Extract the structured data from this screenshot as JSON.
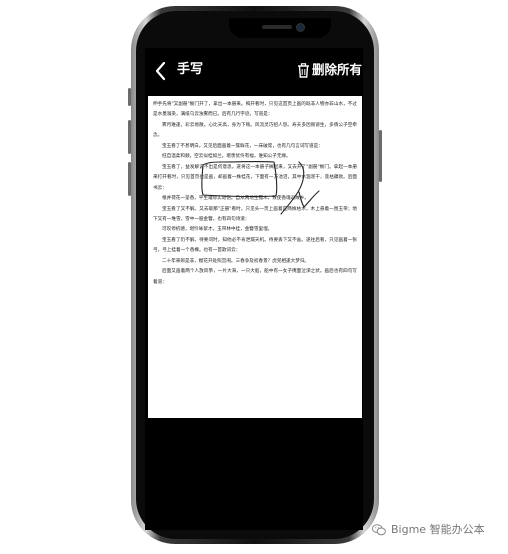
{
  "header": {
    "title": "手写",
    "delete_label": "删除所有",
    "back_icon": "chevron-left-icon",
    "trash_icon": "trash-icon"
  },
  "document": {
    "paragraphs": [
      "伸手先将\"又副册\"橱门开了，拿出一本册来。揭开看时，只见这首页上画的既非人物亦非山水，不过是水墨滃染，满纸乌云浊雾而已。后有几行字迹，写道是：",
      "霁月难逢，彩云易散。心比天高，身为下贱。风流灵巧招人怨。寿夭多因毁谤生，多情公子空牵念。",
      "宝玉看了不甚明白。又见后面画着一簇鲜花，一床破席，也有几句言词写道是：",
      "枉自温柔和顺，空云似桂如兰。堪羡优伶有福，谁知公子无缘。",
      "宝玉看了，益发解说不出是何意思。遂将这一本册子搁起来，又去开了\"副册\"橱门。拿起一本册来打开看时，只见首页也是画，却画着一株桂花，下面有一方池沼，其中水涸泥干，莲枯藕败。后面书云：",
      "根并荷花一茎香，平生遭际实堪伤。自从两地生孤木，致使香魂返故乡。",
      "宝玉看了又不解。又去取那\"正册\"看时，只见头一页上画着是两株枯木，木上悬着一围玉带；地下又有一堆雪，雪中一股金簪。也有四句诗道：",
      "可叹停机德，堪怜咏絮才。玉带林中挂，金簪雪里埋。",
      "宝玉看了仍不解。待要问时，知他必不肯泄漏天机。待要丢下又不舍。遂往后看，只见画着一张弓，弓上挂着一个香橼。也有一首歌词云：",
      "二十年来辨是非，榴花开处照宫闱。三春争及初春景？虎兕相逢大梦归。",
      "后面又画着两个人放风筝，一片大海，一只大船，船中有一女子掩面泣涕之状。画后也有四句写着道："
    ]
  },
  "ink_color": "#222222",
  "watermark": {
    "icon": "wechat-icon",
    "text": "Bigme 智能办公本"
  }
}
